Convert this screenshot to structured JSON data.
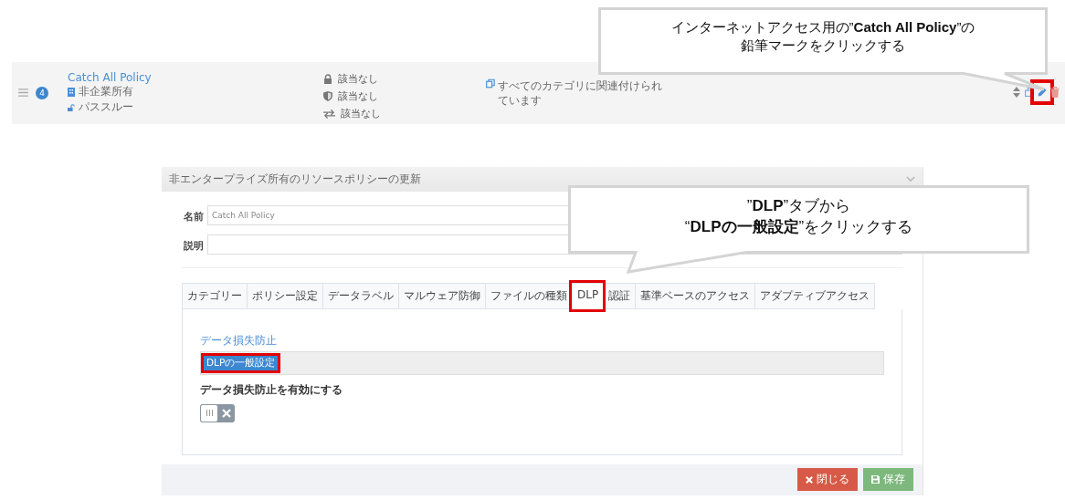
{
  "policy_row": {
    "order": "4",
    "name": "Catch All Policy",
    "ownership": "非企業所有",
    "action": "パススルー",
    "conditions": [
      {
        "kind": "lock",
        "text": "該当なし"
      },
      {
        "kind": "shield",
        "text": "該当なし"
      },
      {
        "kind": "transfer",
        "text": "該当なし"
      }
    ],
    "categories": "すべてのカテゴリに関連付けられています",
    "actions": [
      {
        "kind": "reorder",
        "highlighted": false
      },
      {
        "kind": "copy",
        "highlighted": false
      },
      {
        "kind": "edit",
        "highlighted": true
      },
      {
        "kind": "delete",
        "highlighted": false
      }
    ]
  },
  "dialog": {
    "title": "非エンタープライズ所有のリソースポリシーの更新",
    "fields": [
      {
        "label": "名前",
        "value": "Catch All Policy"
      },
      {
        "label": "説明"
      }
    ],
    "tabs": [
      {
        "label": "カテゴリー",
        "selected": false,
        "highlighted": false
      },
      {
        "label": "ポリシー設定",
        "selected": false,
        "highlighted": false
      },
      {
        "label": "データラベル",
        "selected": false,
        "highlighted": false
      },
      {
        "label": "マルウェア防御",
        "selected": false,
        "highlighted": false
      },
      {
        "label": "ファイルの種類",
        "selected": false,
        "highlighted": false
      },
      {
        "label": "DLP",
        "selected": true,
        "highlighted": true
      },
      {
        "label": "認証",
        "selected": false,
        "highlighted": false
      },
      {
        "label": "基準ベースのアクセス",
        "selected": false,
        "highlighted": false
      },
      {
        "label": "アダプティブアクセス",
        "selected": false,
        "highlighted": false
      }
    ],
    "section_title": "データ損失防止",
    "section_items": [
      {
        "label": "DLPの一般設定",
        "selected": true,
        "highlighted": true
      }
    ],
    "toggle": {
      "label": "データ損失防止を有効にする",
      "on": false
    },
    "buttons": [
      {
        "kind": "close",
        "label": "閉じる"
      },
      {
        "kind": "save",
        "label": "保存"
      }
    ]
  },
  "callouts": [
    {
      "lines": [
        "インターネットアクセス用の”**Catch All Policy**”の",
        "鉛筆マークをクリックする"
      ]
    },
    {
      "lines": [
        "”**DLP**”タブから",
        "“**DLPの一般設定**”をクリックする"
      ]
    }
  ]
}
